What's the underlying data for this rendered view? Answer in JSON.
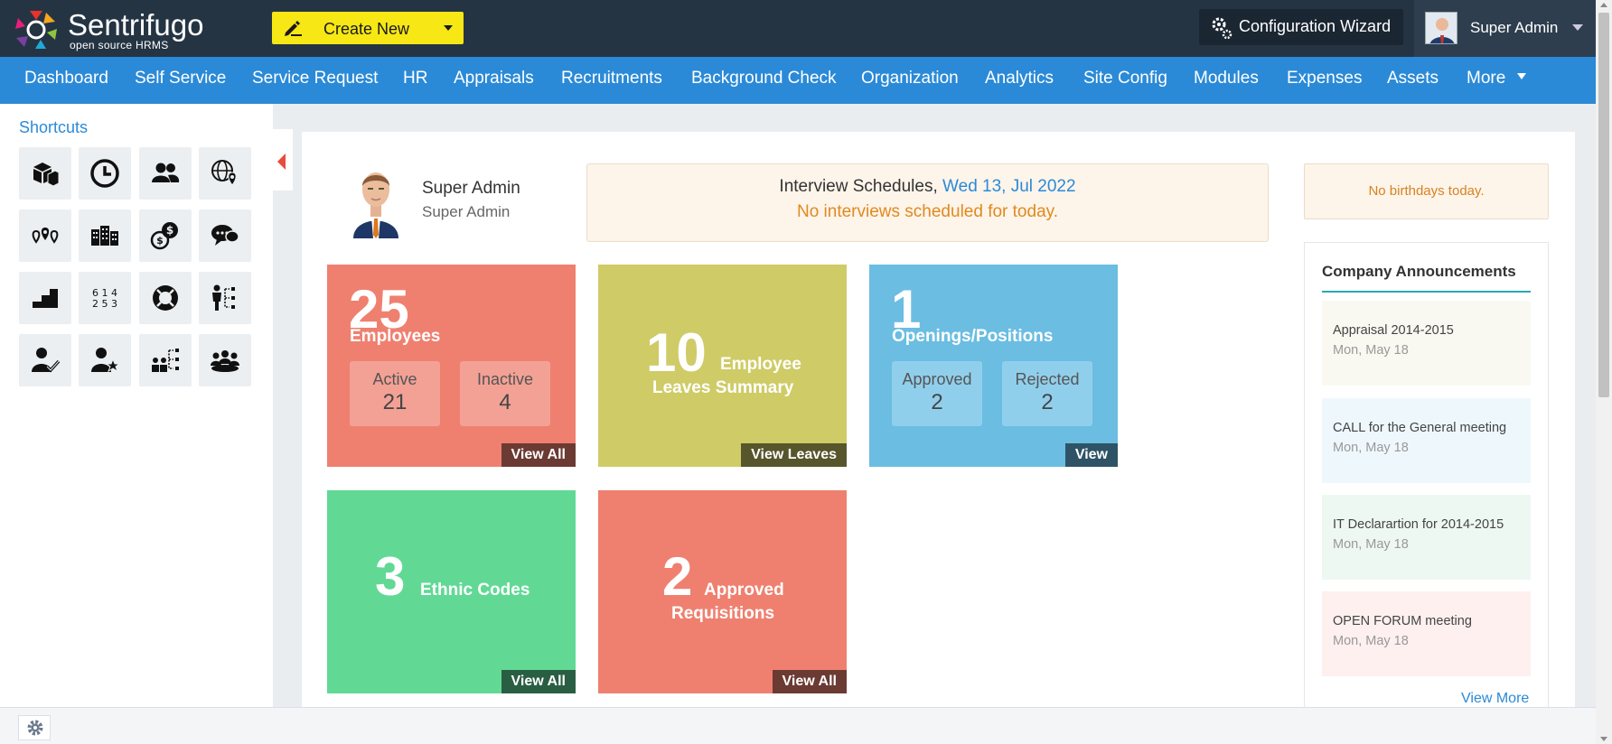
{
  "app": {
    "logo_name": "Sentrifugo",
    "logo_sub": "open source HRMS"
  },
  "header": {
    "create_new": "Create New",
    "config_wizard": "Configuration Wizard",
    "user_name": "Super Admin"
  },
  "nav": {
    "items": [
      "Dashboard",
      "Self Service",
      "Service Request",
      "HR",
      "Appraisals",
      "Recruitments",
      "Background Check",
      "Organization",
      "Analytics",
      "Site Config",
      "Modules",
      "Expenses",
      "Assets",
      "More"
    ]
  },
  "sidebar": {
    "title": "Shortcuts",
    "shortcuts": [
      {
        "icon": "boxes-icon"
      },
      {
        "icon": "clock-icon"
      },
      {
        "icon": "users-icon"
      },
      {
        "icon": "globe-pin-icon"
      },
      {
        "icon": "locations-icon"
      },
      {
        "icon": "buildings-icon"
      },
      {
        "icon": "coins-icon"
      },
      {
        "icon": "chat-bubbles-icon"
      },
      {
        "icon": "steps-icon"
      },
      {
        "icon": "numbers-icon"
      },
      {
        "icon": "lifebuoy-icon"
      },
      {
        "icon": "org-chart-icon"
      },
      {
        "icon": "user-check-icon"
      },
      {
        "icon": "user-star-icon"
      },
      {
        "icon": "hierarchy-icon"
      },
      {
        "icon": "meeting-icon"
      }
    ]
  },
  "profile": {
    "name": "Super Admin",
    "role": "Super Admin"
  },
  "interview": {
    "title": "Interview Schedules,",
    "date": "Wed 13, Jul 2022",
    "message": "No interviews scheduled for today."
  },
  "tiles": {
    "employees": {
      "count": "25",
      "label": "Employees",
      "active_label": "Active",
      "active_value": "21",
      "inactive_label": "Inactive",
      "inactive_value": "4",
      "button": "View All",
      "color": "#ef8070"
    },
    "leaves": {
      "count": "10",
      "label1": "Employee",
      "label2": "Leaves Summary",
      "button": "View Leaves",
      "color": "#cfcb67"
    },
    "openings": {
      "count": "1",
      "label": "Openings/Positions",
      "approved_label": "Approved",
      "approved_value": "2",
      "rejected_label": "Rejected",
      "rejected_value": "2",
      "button": "View",
      "color": "#6bbde2"
    },
    "ethnic": {
      "count": "3",
      "label": "Ethnic Codes",
      "button": "View All",
      "color": "#61d995"
    },
    "requisitions": {
      "count": "2",
      "label1": "Approved",
      "label2": "Requisitions",
      "button": "View All",
      "color": "#ef8070"
    }
  },
  "birthdays": {
    "message": "No birthdays today."
  },
  "announcements": {
    "title": "Company Announcements",
    "items": [
      {
        "title": "Appraisal 2014-2015",
        "date": "Mon, May 18"
      },
      {
        "title": "CALL for the General meeting",
        "date": "Mon, May 18"
      },
      {
        "title": "IT Declarartion for 2014-2015",
        "date": "Mon, May 18"
      },
      {
        "title": "OPEN FORUM meeting",
        "date": "Mon, May 18"
      }
    ],
    "view_more": "View More"
  },
  "footer": {
    "settings_icon": "gear-icon"
  }
}
